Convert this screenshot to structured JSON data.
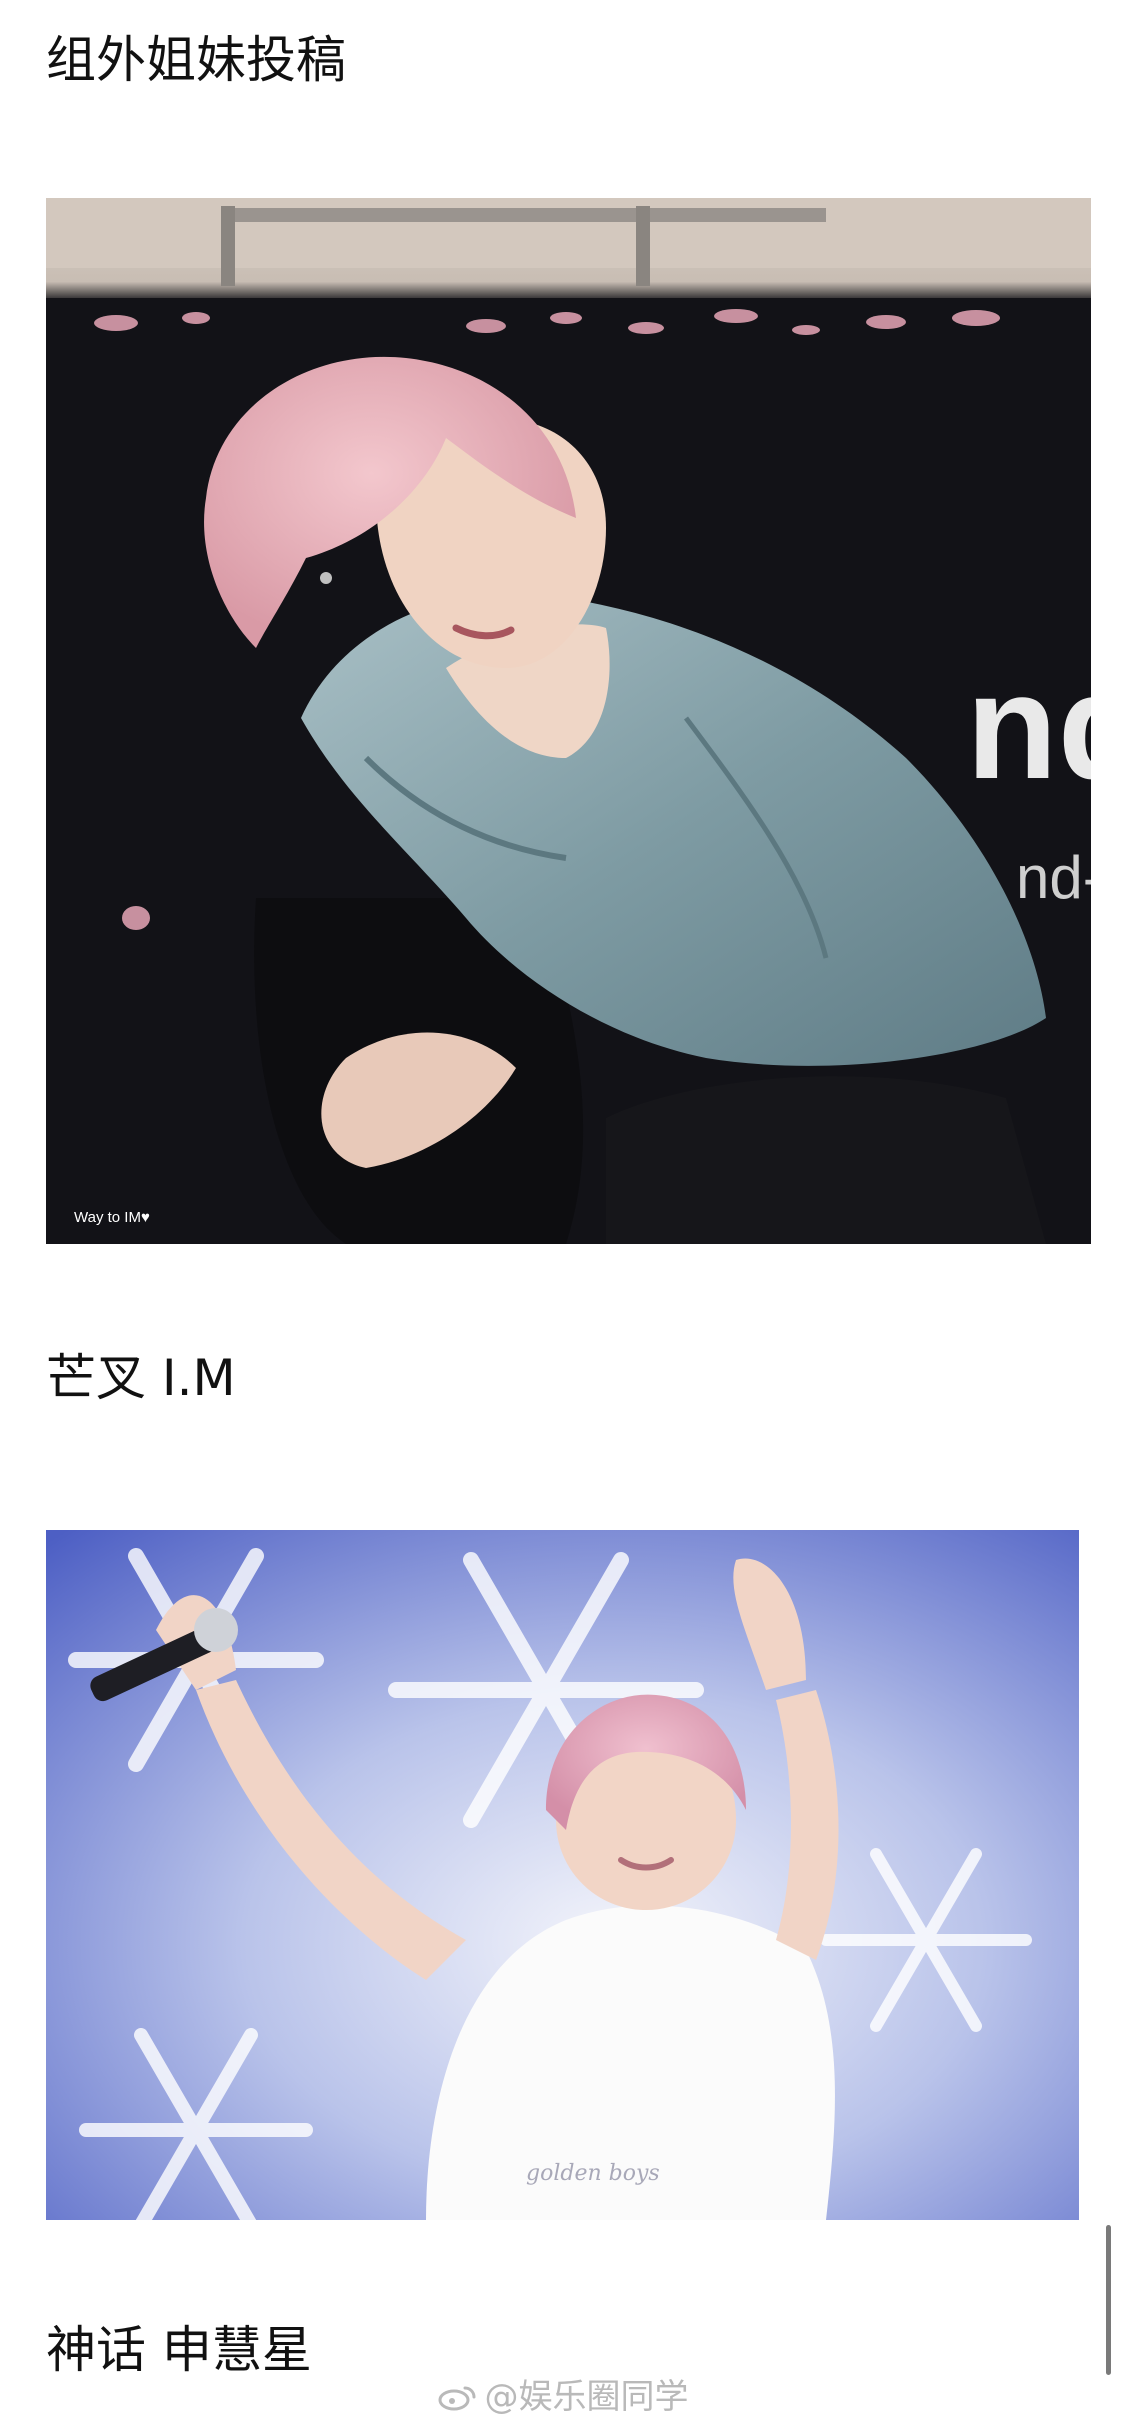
{
  "post": {
    "caption_1": "组外姐妹投稿",
    "caption_2": "芒叉 I.M",
    "caption_3": "神话 申慧星"
  },
  "photos": [
    {
      "subject": "pink-haired man in denim jacket crouching on stage",
      "overlay_text": "Way to IM♥"
    },
    {
      "subject": "pink-haired man in white t-shirt raising arms with microphone in front of snowflake backdrop",
      "overlay_text": "golden boys"
    }
  ],
  "watermark": {
    "text": "@娱乐圈同学",
    "icon": "weibo-logo-icon"
  },
  "colors": {
    "background": "#ffffff",
    "text": "#111111",
    "watermark": "#b9b9b9"
  }
}
